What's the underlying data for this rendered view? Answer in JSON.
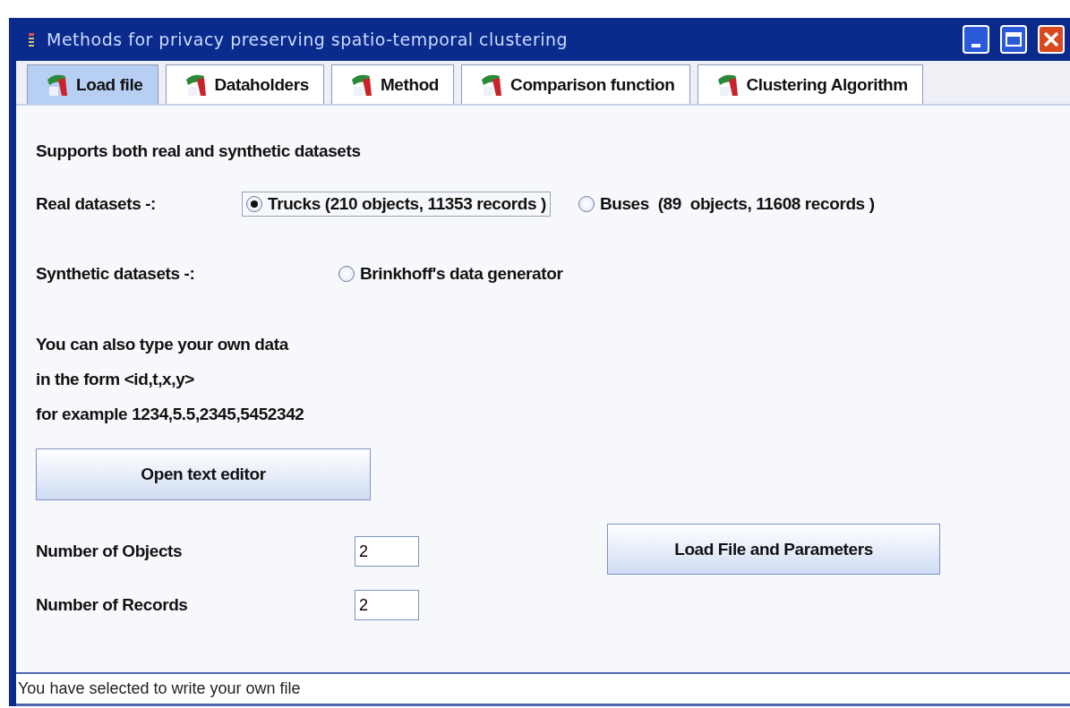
{
  "window": {
    "title": "Methods for privacy preserving spatio-temporal clustering"
  },
  "tabs": [
    {
      "label": "Load file",
      "selected": true
    },
    {
      "label": "Dataholders",
      "selected": false
    },
    {
      "label": "Method",
      "selected": false
    },
    {
      "label": "Comparison function",
      "selected": false
    },
    {
      "label": "Clustering Algorithm",
      "selected": false
    }
  ],
  "intro": "Supports both real and synthetic datasets",
  "dataset_groups": [
    {
      "label": "Real datasets -:",
      "options": [
        {
          "label": "Trucks (210 objects, 11353 records )",
          "selected": true,
          "focused": true
        },
        {
          "label": "Buses  (89  objects, 11608 records )",
          "selected": false,
          "focused": false
        }
      ]
    },
    {
      "label": "Synthetic datasets -:",
      "options": [
        {
          "label": "Brinkhoff's data generator",
          "selected": false,
          "focused": false
        }
      ]
    }
  ],
  "help_lines": [
    "You can also type your own data",
    "in the form <id,t,x,y>",
    "for example 1234,5.5,2345,5452342"
  ],
  "editor_button": "Open text editor",
  "fields": [
    {
      "label": "Number of Objects",
      "value": "2"
    },
    {
      "label": "Number of Records",
      "value": "2"
    }
  ],
  "load_button": "Load File and Parameters",
  "status_bar": "You have selected to write your own file"
}
